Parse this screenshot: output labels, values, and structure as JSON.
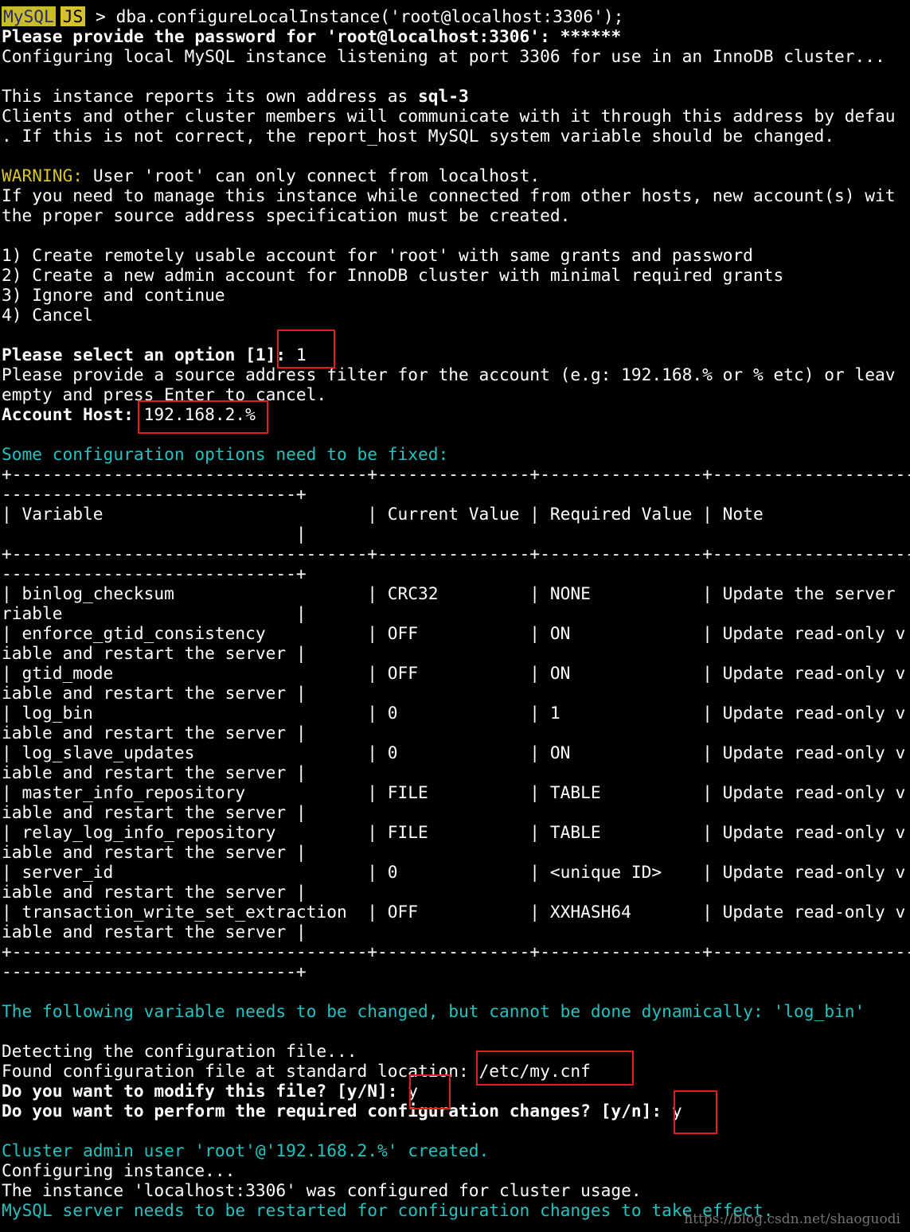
{
  "prompt": {
    "mysql": "MySQL",
    "js": "JS",
    "symbol": " > "
  },
  "command": "dba.configureLocalInstance('root@localhost:3306');",
  "lines": {
    "pw_prompt": "Please provide the password for 'root@localhost:3306': ",
    "pw_mask": "******",
    "configuring": "Configuring local MySQL instance listening at port 3306 for use in an InnoDB cluster...",
    "reports_prefix": "This instance reports its own address as ",
    "reports_addr": "sql-3",
    "clients1": "Clients and other cluster members will communicate with it through this address by defau",
    "clients2": ". If this is not correct, the report_host MySQL system variable should be changed.",
    "warning_label": "WARNING:",
    "warning_text": " User 'root' can only connect from localhost.",
    "if_need1": "If you need to manage this instance while connected from other hosts, new account(s) wit",
    "if_need2": "the proper source address specification must be created.",
    "opt1": "1) Create remotely usable account for 'root' with same grants and password",
    "opt2": "2) Create a new admin account for InnoDB cluster with minimal required grants",
    "opt3": "3) Ignore and continue",
    "opt4": "4) Cancel",
    "select_prompt": "Please select an option [1]: ",
    "select_value": "1",
    "filter1": "Please provide a source address filter for the account (e.g: 192.168.% or % etc) or leav",
    "filter2": "empty and press Enter to cancel.",
    "host_label": "Account Host: ",
    "host_value": "192.168.2.%",
    "some_config": "Some configuration options need to be fixed:",
    "following": "The following variable needs to be changed, but cannot be done dynamically: 'log_bin'",
    "detecting": "Detecting the configuration file...",
    "found_prefix": "Found configuration file at standard location: ",
    "found_path": "/etc/my.cnf",
    "modify_prompt": "Do you want to modify this file? [y/N]: ",
    "modify_value": "y",
    "perform_prompt": "Do you want to perform the required configuration changes? [y/n]: ",
    "perform_value": "y",
    "admin_created": "Cluster admin user 'root'@'192.168.2.%' created.",
    "configuring_instance": "Configuring instance...",
    "configured": "The instance 'localhost:3306' was configured for cluster usage.",
    "restart": "MySQL server needs to be restarted for configuration changes to take effect."
  },
  "table_lines": {
    "border1": "+-----------------------------------+---------------+----------------+--------------------",
    "border2": "-----------------------------+",
    "header1": "| Variable                          | Current Value | Required Value | Note",
    "header2": "                             |",
    "rows": [
      {
        "a": "| binlog_checksum                   | CRC32         | NONE           | Update the server ",
        "b": "riable                       |"
      },
      {
        "a": "| enforce_gtid_consistency          | OFF           | ON             | Update read-only v",
        "b": "iable and restart the server |"
      },
      {
        "a": "| gtid_mode                         | OFF           | ON             | Update read-only v",
        "b": "iable and restart the server |"
      },
      {
        "a": "| log_bin                           | 0             | 1              | Update read-only v",
        "b": "iable and restart the server |"
      },
      {
        "a": "| log_slave_updates                 | 0             | ON             | Update read-only v",
        "b": "iable and restart the server |"
      },
      {
        "a": "| master_info_repository            | FILE          | TABLE          | Update read-only v",
        "b": "iable and restart the server |"
      },
      {
        "a": "| relay_log_info_repository         | FILE          | TABLE          | Update read-only v",
        "b": "iable and restart the server |"
      },
      {
        "a": "| server_id                         | 0             | <unique ID>    | Update read-only v",
        "b": "iable and restart the server |"
      },
      {
        "a": "| transaction_write_set_extraction  | OFF           | XXHASH64       | Update read-only v",
        "b": "iable and restart the server |"
      }
    ]
  },
  "watermark": "https://blog.csdn.net/shaoguodi",
  "colors": {
    "background": "#000000",
    "text": "#ffffff",
    "cyan": "#22c3c0",
    "warning": "#d7c32a",
    "highlight_box": "#e0201c"
  }
}
